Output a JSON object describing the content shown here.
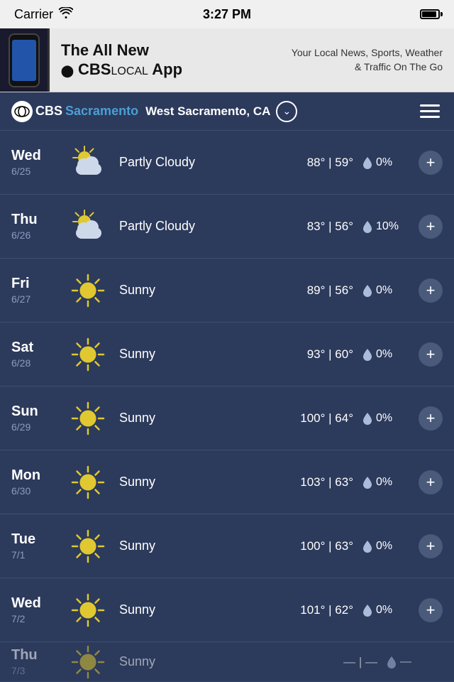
{
  "statusBar": {
    "carrier": "Carrier",
    "time": "3:27 PM"
  },
  "ad": {
    "title_line1": "The All New",
    "title_cbs": "CBS",
    "title_local": "LOCAL",
    "title_line2": "App",
    "tagline": "Your Local News, Sports, Weather & Traffic On The Go"
  },
  "header": {
    "cbs_label": "CBS",
    "sacramento_label": "Sacramento",
    "location": "West Sacramento, CA"
  },
  "weather_rows": [
    {
      "day": "Wed",
      "date": "6/25",
      "condition": "Partly Cloudy",
      "icon": "partly-cloudy",
      "high": "88°",
      "low": "59°",
      "rain": "0%"
    },
    {
      "day": "Thu",
      "date": "6/26",
      "condition": "Partly Cloudy",
      "icon": "partly-cloudy",
      "high": "83°",
      "low": "56°",
      "rain": "10%"
    },
    {
      "day": "Fri",
      "date": "6/27",
      "condition": "Sunny",
      "icon": "sunny",
      "high": "89°",
      "low": "56°",
      "rain": "0%"
    },
    {
      "day": "Sat",
      "date": "6/28",
      "condition": "Sunny",
      "icon": "sunny",
      "high": "93°",
      "low": "60°",
      "rain": "0%"
    },
    {
      "day": "Sun",
      "date": "6/29",
      "condition": "Sunny",
      "icon": "sunny",
      "high": "100°",
      "low": "64°",
      "rain": "0%"
    },
    {
      "day": "Mon",
      "date": "6/30",
      "condition": "Sunny",
      "icon": "sunny",
      "high": "103°",
      "low": "63°",
      "rain": "0%"
    },
    {
      "day": "Tue",
      "date": "7/1",
      "condition": "Sunny",
      "icon": "sunny",
      "high": "100°",
      "low": "63°",
      "rain": "0%"
    },
    {
      "day": "Wed",
      "date": "7/2",
      "condition": "Sunny",
      "icon": "sunny",
      "high": "101°",
      "low": "62°",
      "rain": "0%"
    },
    {
      "day": "Thu",
      "date": "7/3",
      "condition": "Sunny",
      "icon": "sunny",
      "high": "—",
      "low": "—",
      "rain": "—",
      "partial": true
    }
  ]
}
